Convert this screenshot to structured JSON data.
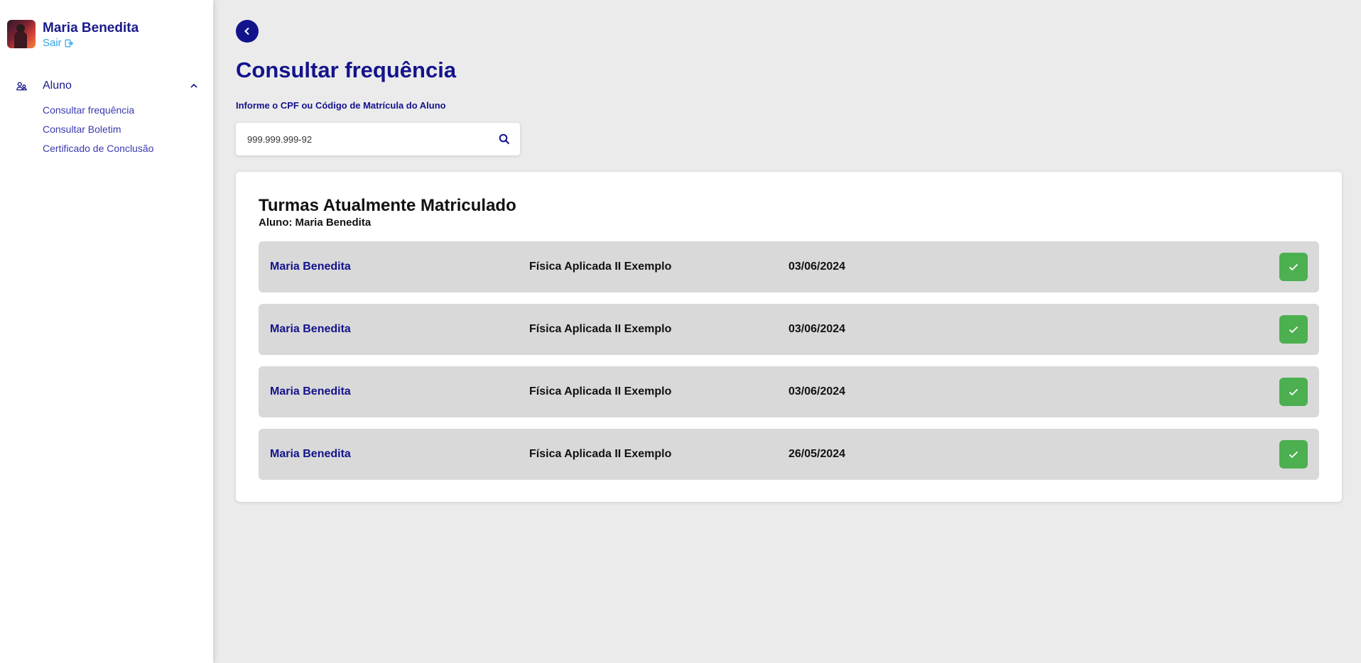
{
  "sidebar": {
    "user_name": "Maria Benedita",
    "logout_label": "Sair",
    "nav": {
      "group_label": "Aluno",
      "items": [
        {
          "label": "Consultar frequência"
        },
        {
          "label": "Consultar Boletim"
        },
        {
          "label": "Certificado de Conclusão"
        }
      ]
    }
  },
  "main": {
    "page_title": "Consultar frequência",
    "search": {
      "label": "Informe o CPF ou Código de Matrícula do Aluno",
      "value": "999.999.999-92",
      "placeholder": ""
    },
    "card": {
      "title": "Turmas Atualmente Matriculado",
      "subtitle_prefix": "Aluno:",
      "subtitle_name": "Maria Benedita",
      "rows": [
        {
          "name": "Maria Benedita",
          "course": "Física Aplicada II Exemplo",
          "date": "03/06/2024",
          "status": "check"
        },
        {
          "name": "Maria Benedita",
          "course": "Física Aplicada II Exemplo",
          "date": "03/06/2024",
          "status": "check"
        },
        {
          "name": "Maria Benedita",
          "course": "Física Aplicada II Exemplo",
          "date": "03/06/2024",
          "status": "check"
        },
        {
          "name": "Maria Benedita",
          "course": "Física Aplicada II Exemplo",
          "date": "26/05/2024",
          "status": "check"
        }
      ]
    }
  },
  "colors": {
    "brand": "#13138c",
    "link": "#2aa4e8",
    "success": "#4caf50",
    "row_bg": "#d9d9d9",
    "page_bg": "#ebebeb"
  },
  "icons": {
    "back": "chevron-left-icon",
    "logout": "logout-icon",
    "group": "users-icon",
    "collapse": "chevron-up-icon",
    "search": "search-icon",
    "status": "check-icon"
  }
}
